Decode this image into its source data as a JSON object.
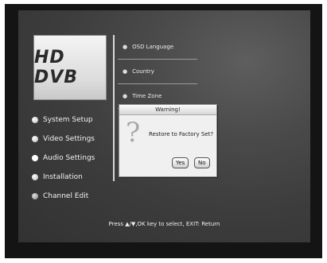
{
  "logo": {
    "text": "HD DVB"
  },
  "left_menu": [
    {
      "label": "System Setup"
    },
    {
      "label": "Video Settings"
    },
    {
      "label": "Audio Settings"
    },
    {
      "label": "Installation"
    },
    {
      "label": "Channel Edit"
    }
  ],
  "submenu": [
    {
      "label": "OSD Language"
    },
    {
      "label": "Country"
    },
    {
      "label": "Time Zone"
    }
  ],
  "dialog": {
    "title": "Warning!",
    "message": "Restore to Factory Set?",
    "icon": "question-mark-icon",
    "yes_label": "Yes",
    "no_label": "No"
  },
  "footer": {
    "hint": "Press ▲/▼,OK key to select, EXIT: Return"
  }
}
